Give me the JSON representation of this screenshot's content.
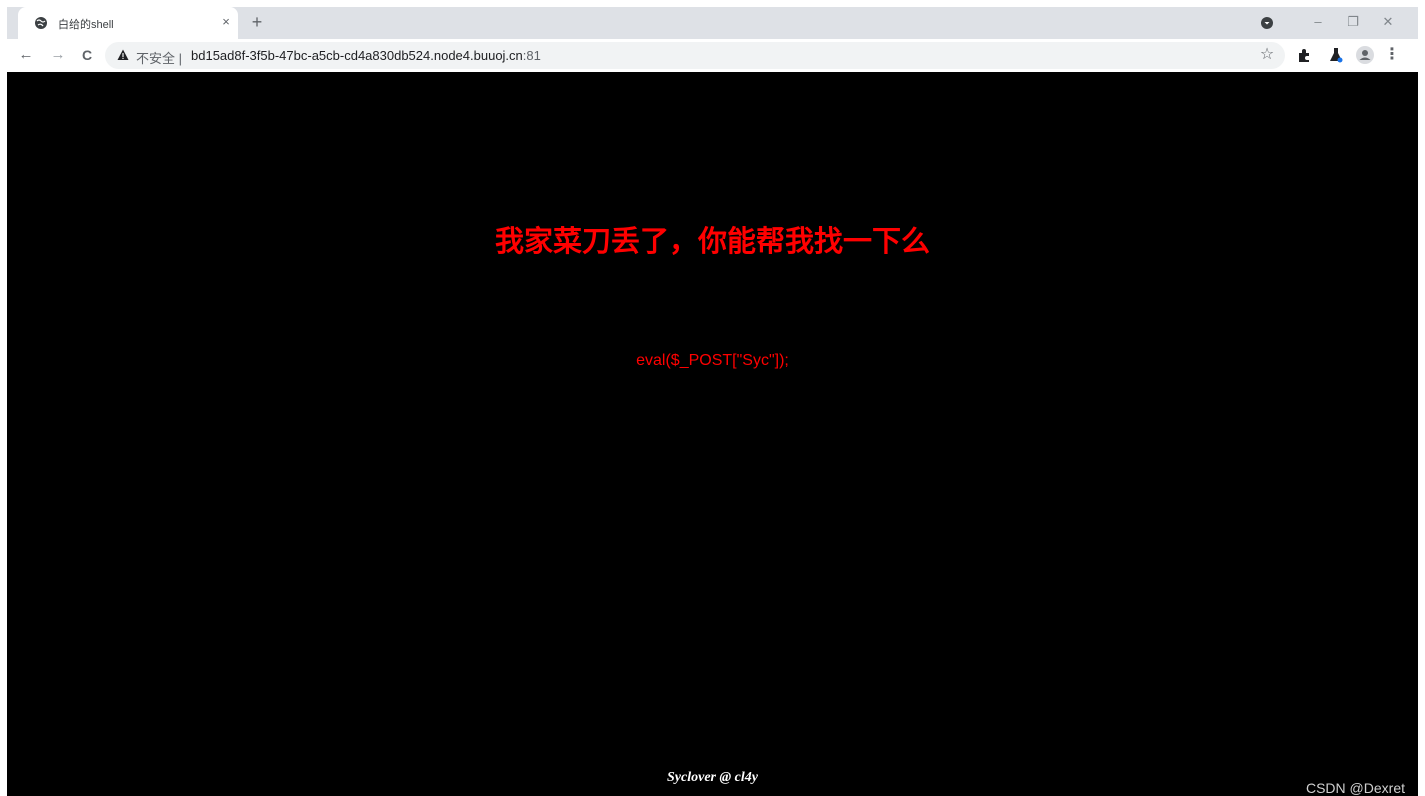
{
  "browser": {
    "tab": {
      "title": "白给的shell",
      "close_glyph": "×",
      "favicon_icon": "globe-icon"
    },
    "new_tab_glyph": "+",
    "window_controls": {
      "minimize": "–",
      "restore": "❐",
      "close": "✕"
    },
    "toolbar": {
      "back": "←",
      "forward": "→",
      "reload": "C",
      "security_label": "不安全",
      "separator": "|",
      "url_host": "bd15ad8f-3f5b-47bc-a5cb-cd4a830db524.node4.buuoj.cn",
      "url_port": ":81",
      "bookmark_star": "☆",
      "menu": "⋮"
    }
  },
  "page": {
    "headline": "我家菜刀丢了，你能帮我找一下么",
    "code": "eval($_POST[\"Syc\"]);",
    "footer": "Syclover @ cl4y",
    "watermark": "CSDN @Dexret"
  },
  "colors": {
    "page_background": "#000000",
    "headline": "#ff0000",
    "code": "#ff0000",
    "footer": "#ffffff"
  }
}
